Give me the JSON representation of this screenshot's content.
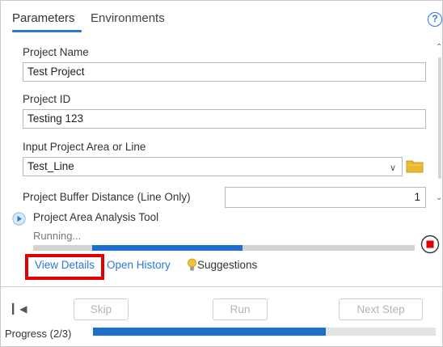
{
  "tabs": [
    {
      "label": "Parameters",
      "active": true
    },
    {
      "label": "Environments",
      "active": false
    }
  ],
  "help_icon": {
    "glyph": "?",
    "color": "#2a7ad2"
  },
  "fields": {
    "project_name": {
      "label": "Project Name",
      "value": "Test Project"
    },
    "project_id": {
      "label": "Project ID",
      "value": "Testing 123"
    },
    "input_area": {
      "label": "Input Project Area or Line",
      "value": "Test_Line"
    },
    "buffer_distance": {
      "label": "Project Buffer Distance (Line Only)",
      "value": "1"
    }
  },
  "tool": {
    "name": "Project Area Analysis Tool",
    "status": "Running...",
    "progress_fraction_start": 0.155,
    "progress_fraction_end": 0.55
  },
  "links": {
    "view_details": "View Details",
    "open_history": "Open History",
    "suggestions": "Suggestions"
  },
  "buttons": {
    "skip": "Skip",
    "run": "Run",
    "next_step": "Next Step"
  },
  "overall_progress": {
    "label": "Progress (2/3)",
    "fraction": 0.68
  },
  "colors": {
    "accent": "#2a7ad2",
    "progress": "#1c6fcb",
    "stop": "#e00000",
    "highlight": "#e00000"
  }
}
